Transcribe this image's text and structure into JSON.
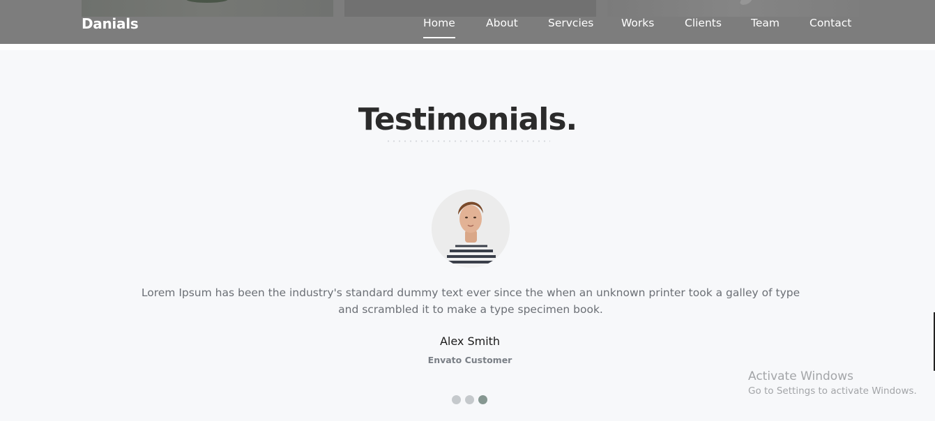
{
  "brand": {
    "name": "Danials"
  },
  "nav": {
    "items": [
      {
        "label": "Home",
        "active": true
      },
      {
        "label": "About",
        "active": false
      },
      {
        "label": "Servcies",
        "active": false
      },
      {
        "label": "Works",
        "active": false
      },
      {
        "label": "Clients",
        "active": false
      },
      {
        "label": "Team",
        "active": false
      },
      {
        "label": "Contact",
        "active": false
      }
    ]
  },
  "testimonials": {
    "title": "Testimonials.",
    "quote_line1": "Lorem Ipsum has been the industry's standard dummy text ever since the when an unknown printer took a galley of type",
    "quote_line2": "and scrambled it to make a type specimen book.",
    "name": "Alex Smith",
    "role": "Envato Customer",
    "slide_count": 3,
    "active_slide": 3
  },
  "watermark": {
    "title": "Activate Windows",
    "subtitle": "Go to Settings to activate Windows."
  },
  "colors": {
    "navbar_bg": "#7d7d7d",
    "section_bg": "#f7f8fa",
    "active_dot": "#869791",
    "inactive_dot": "#c5c9cc"
  }
}
